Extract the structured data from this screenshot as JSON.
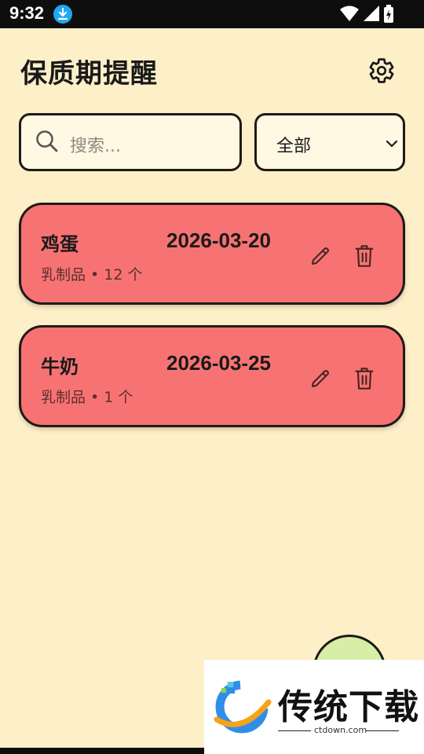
{
  "status_bar": {
    "time": "9:32",
    "icons": [
      "download-badge-icon",
      "wifi-icon",
      "signal-icon",
      "battery-charging-icon"
    ]
  },
  "header": {
    "title": "保质期提醒",
    "settings_icon": "gear-icon"
  },
  "search": {
    "placeholder": "搜索...",
    "icon": "search-icon"
  },
  "filter": {
    "selected": "全部",
    "icon": "chevron-down-icon"
  },
  "items": [
    {
      "name": "鸡蛋",
      "date": "2026-03-20",
      "meta": "乳制品 • 12 个"
    },
    {
      "name": "牛奶",
      "date": "2026-03-25",
      "meta": "乳制品 • 1 个"
    }
  ],
  "fab": {
    "icon": "add-icon"
  },
  "watermark": {
    "text": "传统下载",
    "url": "ctdown.com"
  },
  "colors": {
    "background": "#fdefc8",
    "card": "#f77373",
    "fab": "#d6eea6",
    "border": "#1f1a17"
  }
}
